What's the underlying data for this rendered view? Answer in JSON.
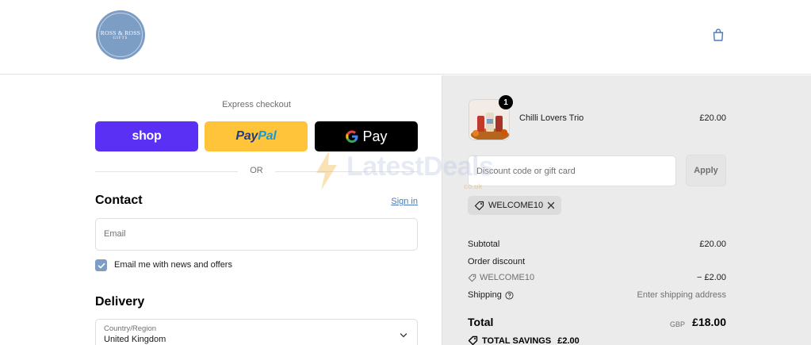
{
  "header": {
    "logo_line1": "ROSS & ROSS",
    "logo_line2": "GIFTS",
    "cart_icon": "shopping-bag-icon"
  },
  "checkout": {
    "express_label": "Express checkout",
    "shop_label": "shop",
    "paypal_label_a": "Pay",
    "paypal_label_b": "Pal",
    "gpay_label": "Pay",
    "or_label": "OR"
  },
  "contact": {
    "title": "Contact",
    "sign_in": "Sign in",
    "email_placeholder": "Email",
    "newsletter_label": "Email me with news and offers",
    "newsletter_checked": true
  },
  "delivery": {
    "title": "Delivery",
    "country_label": "Country/Region",
    "country_value": "United Kingdom"
  },
  "order": {
    "product_name": "Chilli Lovers Trio",
    "product_price": "£20.00",
    "quantity": "1",
    "discount_placeholder": "Discount code or gift card",
    "apply_label": "Apply",
    "applied_code": "WELCOME10",
    "subtotal_label": "Subtotal",
    "subtotal_value": "£20.00",
    "order_discount_label": "Order discount",
    "discount_code": "WELCOME10",
    "discount_value": "− £2.00",
    "shipping_label": "Shipping",
    "shipping_value": "Enter shipping address",
    "total_label": "Total",
    "total_currency": "GBP",
    "total_value": "£18.00",
    "savings_label": "TOTAL SAVINGS",
    "savings_value": "£2.00"
  },
  "watermark": {
    "text": "LatestDeals",
    "sub": "co.uk"
  },
  "colors": {
    "accent": "#7d9ec4",
    "shop_pay": "#5a31f4",
    "paypal": "#ffc439",
    "gpay": "#000000",
    "summary_bg": "#ebebeb"
  }
}
